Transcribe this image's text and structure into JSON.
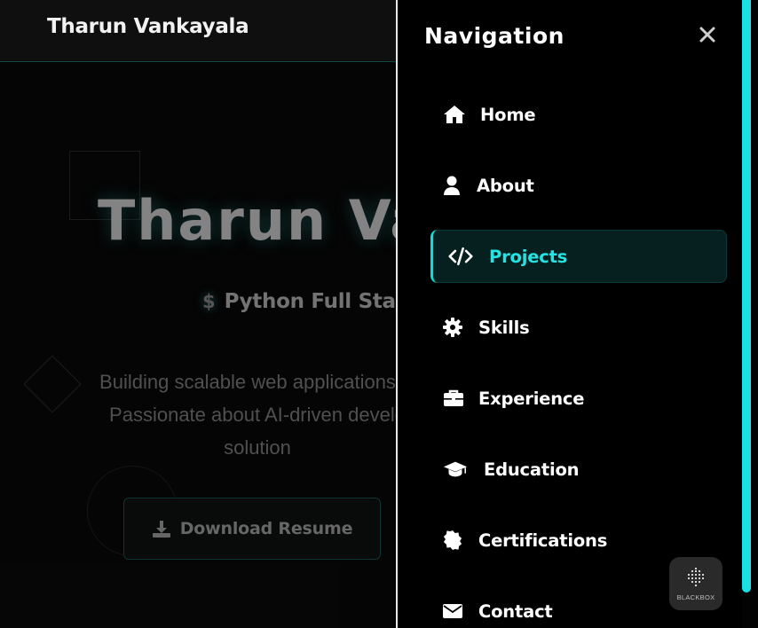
{
  "page": {
    "brand": "Tharun Vankayala",
    "hero_title": "Tharun Va",
    "role_prefix": "$",
    "role_text": "Python Full Stac",
    "description_lines": [
      "Building scalable web applications w",
      "Passionate about AI-driven develo",
      "solution"
    ],
    "download_button": "Download Resume",
    "colors": {
      "accent": "#16d9d9",
      "background": "#060606",
      "hero_text": "#8b8b8b"
    }
  },
  "drawer": {
    "title": "Navigation",
    "close_icon": "close-icon",
    "items": [
      {
        "label": "Home",
        "icon": "home-icon",
        "active": false
      },
      {
        "label": "About",
        "icon": "user-icon",
        "active": false
      },
      {
        "label": "Projects",
        "icon": "code-icon",
        "active": true
      },
      {
        "label": "Skills",
        "icon": "gear-icon",
        "active": false
      },
      {
        "label": "Experience",
        "icon": "briefcase-icon",
        "active": false
      },
      {
        "label": "Education",
        "icon": "graduation-cap-icon",
        "active": false
      },
      {
        "label": "Certifications",
        "icon": "badge-icon",
        "active": false
      },
      {
        "label": "Contact",
        "icon": "envelope-icon",
        "active": false
      }
    ],
    "active_color": "#22e4e4",
    "active_background": "#05201f"
  },
  "widget": {
    "label": "BLACKBOX"
  }
}
